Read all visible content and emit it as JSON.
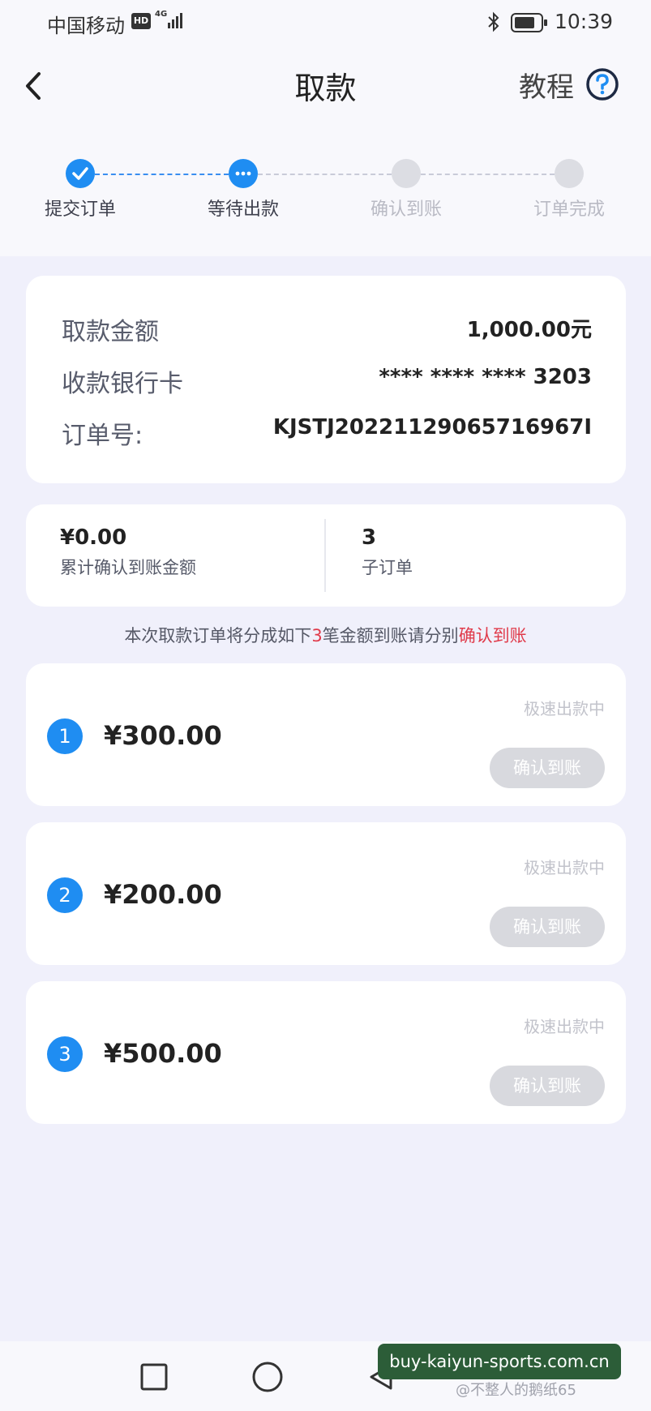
{
  "status_bar": {
    "carrier": "中国移动",
    "hd": "HD",
    "network": "4G",
    "time": "10:39"
  },
  "header": {
    "title": "取款",
    "tutorial_label": "教程"
  },
  "stepper": {
    "steps": [
      {
        "label": "提交订单",
        "state": "done"
      },
      {
        "label": "等待出款",
        "state": "current"
      },
      {
        "label": "确认到账",
        "state": "pending"
      },
      {
        "label": "订单完成",
        "state": "pending"
      }
    ]
  },
  "order_info": {
    "amount_label": "取款金额",
    "amount_value": "1,000.00元",
    "card_label": "收款银行卡",
    "card_value": "**** **** **** 3203",
    "order_no_label": "订单号:",
    "order_no_value": "KJSTJ20221129065716967I"
  },
  "stats": {
    "confirmed_amount": "¥0.00",
    "confirmed_label": "累计确认到账金额",
    "sub_order_count": "3",
    "sub_order_label": "子订单"
  },
  "notice": {
    "prefix": "本次取款订单将分成如下",
    "count": "3",
    "middle": "笔金额到账请分别",
    "action": "确认到账"
  },
  "sub_orders": [
    {
      "index": "1",
      "amount": "¥300.00",
      "status": "极速出款中",
      "button": "确认到账"
    },
    {
      "index": "2",
      "amount": "¥200.00",
      "status": "极速出款中",
      "button": "确认到账"
    },
    {
      "index": "3",
      "amount": "¥500.00",
      "status": "极速出款中",
      "button": "确认到账"
    }
  ],
  "watermark": {
    "site": "buy-kaiyun-sports.com.cn",
    "credit": "@不整人的鹅纸65"
  },
  "colors": {
    "accent": "#1f8df2",
    "highlight": "#e03a4a",
    "disabled_button": "#d8d9de"
  },
  "icons": {
    "back": "chevron-left-icon",
    "help": "question-circle-icon",
    "nav_recent": "square-icon",
    "nav_home": "circle-icon",
    "nav_back": "triangle-icon"
  }
}
